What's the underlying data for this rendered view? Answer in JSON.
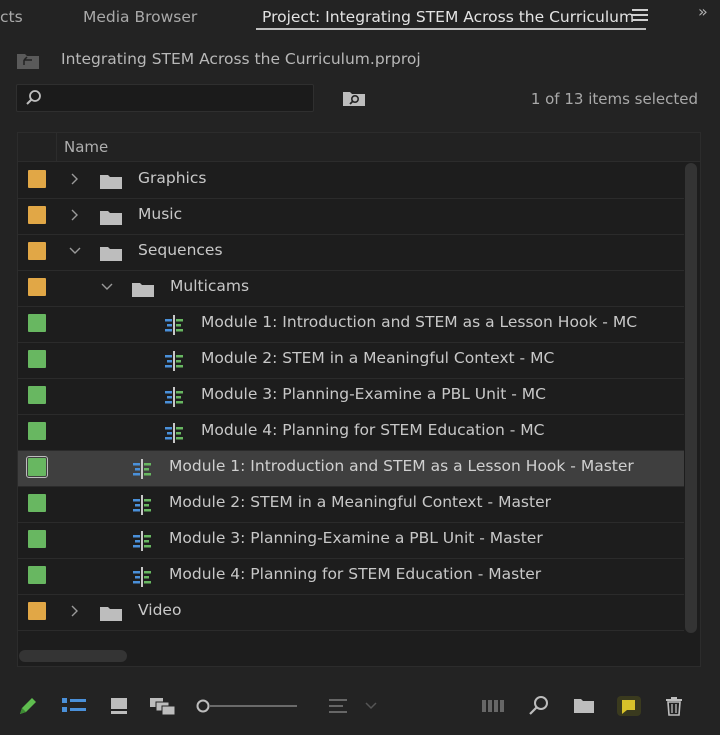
{
  "tabs": [
    {
      "label": "cts",
      "active": false
    },
    {
      "label": "Media Browser",
      "active": false
    },
    {
      "label": "Project: Integrating STEM Across the Curriculum",
      "active": true
    }
  ],
  "overflow_glyph": "»",
  "project": {
    "file_name": "Integrating STEM Across the Curriculum.prproj"
  },
  "search": {
    "value": "",
    "placeholder": ""
  },
  "selection_status": "1 of 13 items selected",
  "list": {
    "column_header": "Name",
    "rows": [
      {
        "name": "Graphics",
        "type": "bin",
        "label_color": "#e1a746",
        "depth": 0,
        "expanded": false,
        "selected": false
      },
      {
        "name": "Music",
        "type": "bin",
        "label_color": "#e1a746",
        "depth": 0,
        "expanded": false,
        "selected": false
      },
      {
        "name": "Sequences",
        "type": "bin",
        "label_color": "#e1a746",
        "depth": 0,
        "expanded": true,
        "selected": false
      },
      {
        "name": "Multicams",
        "type": "bin",
        "label_color": "#e1a746",
        "depth": 1,
        "expanded": true,
        "selected": false
      },
      {
        "name": "Module 1: Introduction and STEM as a Lesson Hook - MC",
        "type": "sequence",
        "label_color": "#68b761",
        "depth": 2,
        "selected": false
      },
      {
        "name": "Module 2: STEM in a Meaningful Context - MC",
        "type": "sequence",
        "label_color": "#68b761",
        "depth": 2,
        "selected": false
      },
      {
        "name": "Module 3: Planning-Examine a PBL Unit - MC",
        "type": "sequence",
        "label_color": "#68b761",
        "depth": 2,
        "selected": false
      },
      {
        "name": "Module 4: Planning for STEM Education - MC",
        "type": "sequence",
        "label_color": "#68b761",
        "depth": 2,
        "selected": false
      },
      {
        "name": "Module 1: Introduction and STEM as a Lesson Hook - Master",
        "type": "sequence",
        "label_color": "#68b761",
        "depth": 1,
        "selected": true
      },
      {
        "name": "Module 2: STEM in a Meaningful Context - Master",
        "type": "sequence",
        "label_color": "#68b761",
        "depth": 1,
        "selected": false
      },
      {
        "name": "Module 3: Planning-Examine a PBL Unit - Master",
        "type": "sequence",
        "label_color": "#68b761",
        "depth": 1,
        "selected": false
      },
      {
        "name": "Module 4: Planning for STEM Education - Master",
        "type": "sequence",
        "label_color": "#68b761",
        "depth": 1,
        "selected": false
      },
      {
        "name": "Video",
        "type": "bin",
        "label_color": "#e1a746",
        "depth": 0,
        "expanded": false,
        "selected": false
      }
    ]
  },
  "toolbar": {
    "icons": [
      "pencil-icon",
      "list-view-icon",
      "icon-view-icon",
      "freeform-view-icon",
      "zoom-slider",
      "sort-icon",
      "automate-to-sequence-icon",
      "find-icon",
      "new-bin-icon",
      "new-item-icon",
      "clear-icon"
    ]
  },
  "colors": {
    "accent_blue": "#4a90d9",
    "bin_label": "#e1a746",
    "sequence_label": "#68b761",
    "pencil_green": "#5fbd4f",
    "new_item_yellow": "#d8c22a"
  }
}
